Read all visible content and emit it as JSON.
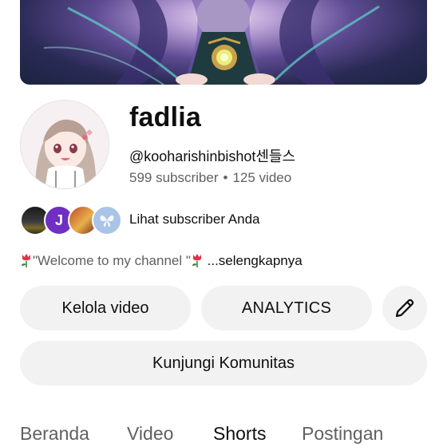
{
  "channel": {
    "name": "fadlia",
    "handle": "@kooharishinbishot센들스",
    "subscribers": "599 subscriber",
    "separator": "•",
    "videos": "125 video"
  },
  "subscribers_row": {
    "label": "Lihat subscriber Anda",
    "avatar_initial": "J"
  },
  "description": {
    "text": "\"Welcome to my channel \"",
    "more": "...selengkapnya"
  },
  "buttons": {
    "manage_videos": "Kelola video",
    "analytics": "ANALYTICS",
    "community": "Kunjungi Komunitas"
  },
  "tabs": [
    "Beranda",
    "Video",
    "Shorts",
    "Postingan"
  ],
  "colors": {
    "button_bg": "#f2f2f2",
    "secondary_text": "#606060",
    "avatar_j": "#6f2fc2"
  }
}
